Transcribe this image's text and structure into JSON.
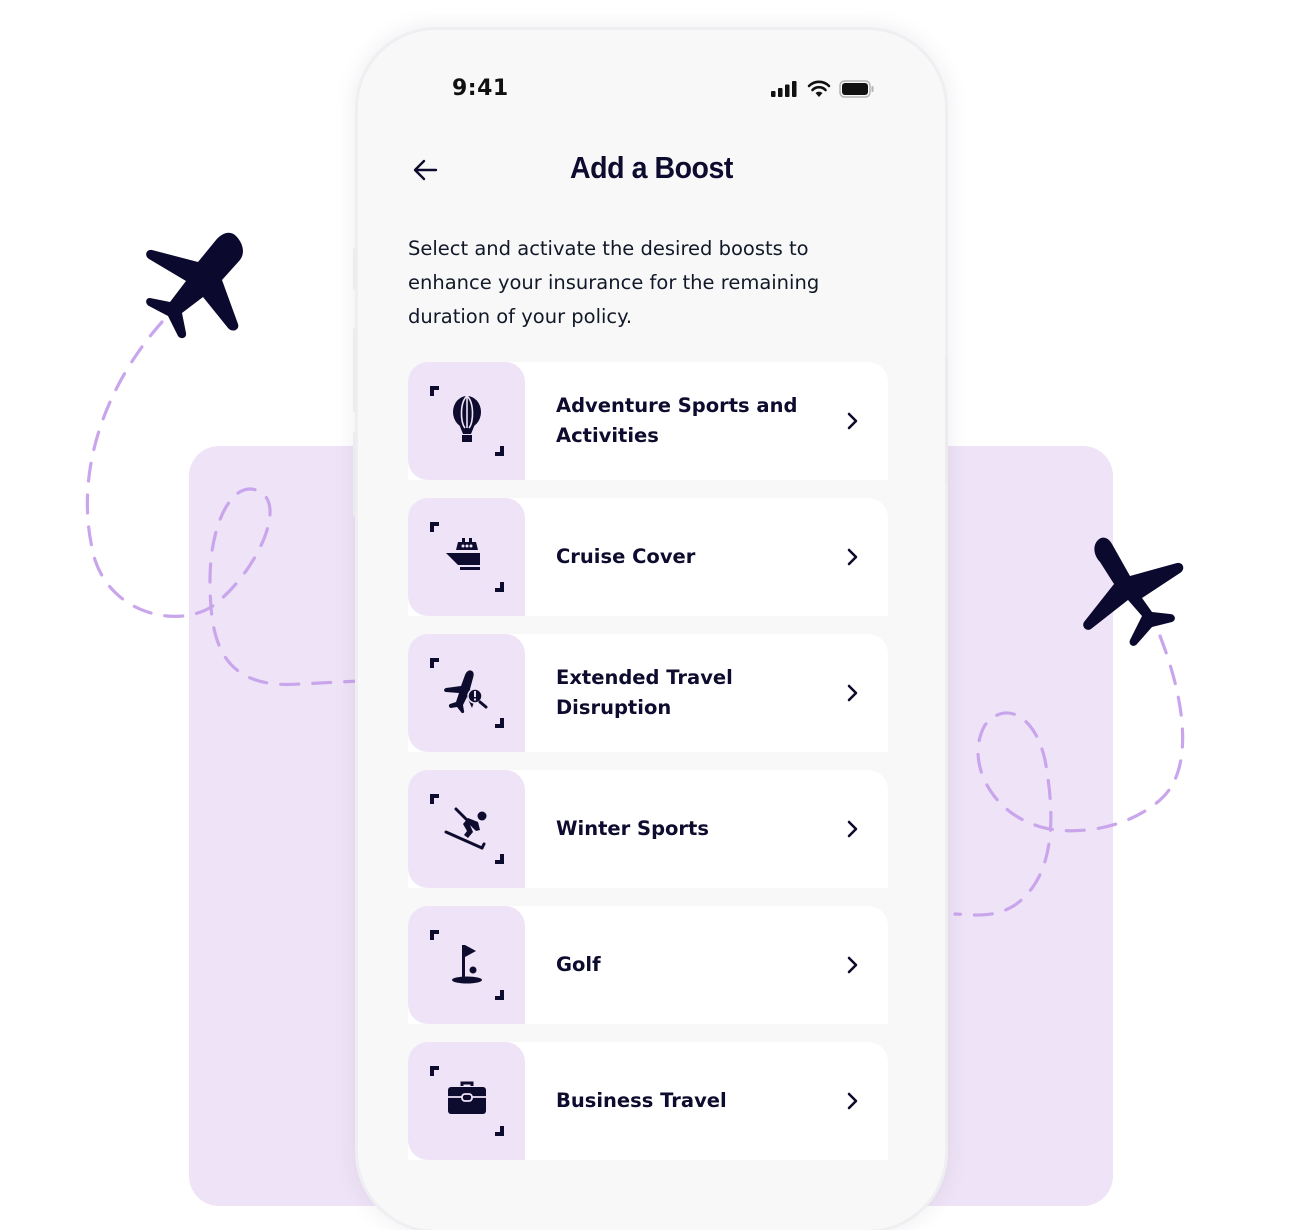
{
  "status_bar": {
    "time": "9:41",
    "icons": [
      "cellular-signal-icon",
      "wifi-icon",
      "battery-icon"
    ]
  },
  "header": {
    "back_icon": "arrow-left-icon",
    "title": "Add a Boost"
  },
  "description": "Select and activate the desired boosts to enhance your insurance for the remaining duration of your policy.",
  "boosts": [
    {
      "label": "Adventure Sports and Activities",
      "icon": "hot-air-balloon-icon"
    },
    {
      "label": "Cruise Cover",
      "icon": "cruise-ship-icon"
    },
    {
      "label": "Extended Travel Disruption",
      "icon": "flight-alert-icon"
    },
    {
      "label": "Winter Sports",
      "icon": "skiing-icon"
    },
    {
      "label": "Golf",
      "icon": "golf-flag-icon"
    },
    {
      "label": "Business Travel",
      "icon": "briefcase-icon"
    }
  ],
  "colors": {
    "navy": "#0e0c2e",
    "lavender": "#efe3f7",
    "dash_purple": "#c9a6ec",
    "screen_bg": "#f8f8f9"
  }
}
